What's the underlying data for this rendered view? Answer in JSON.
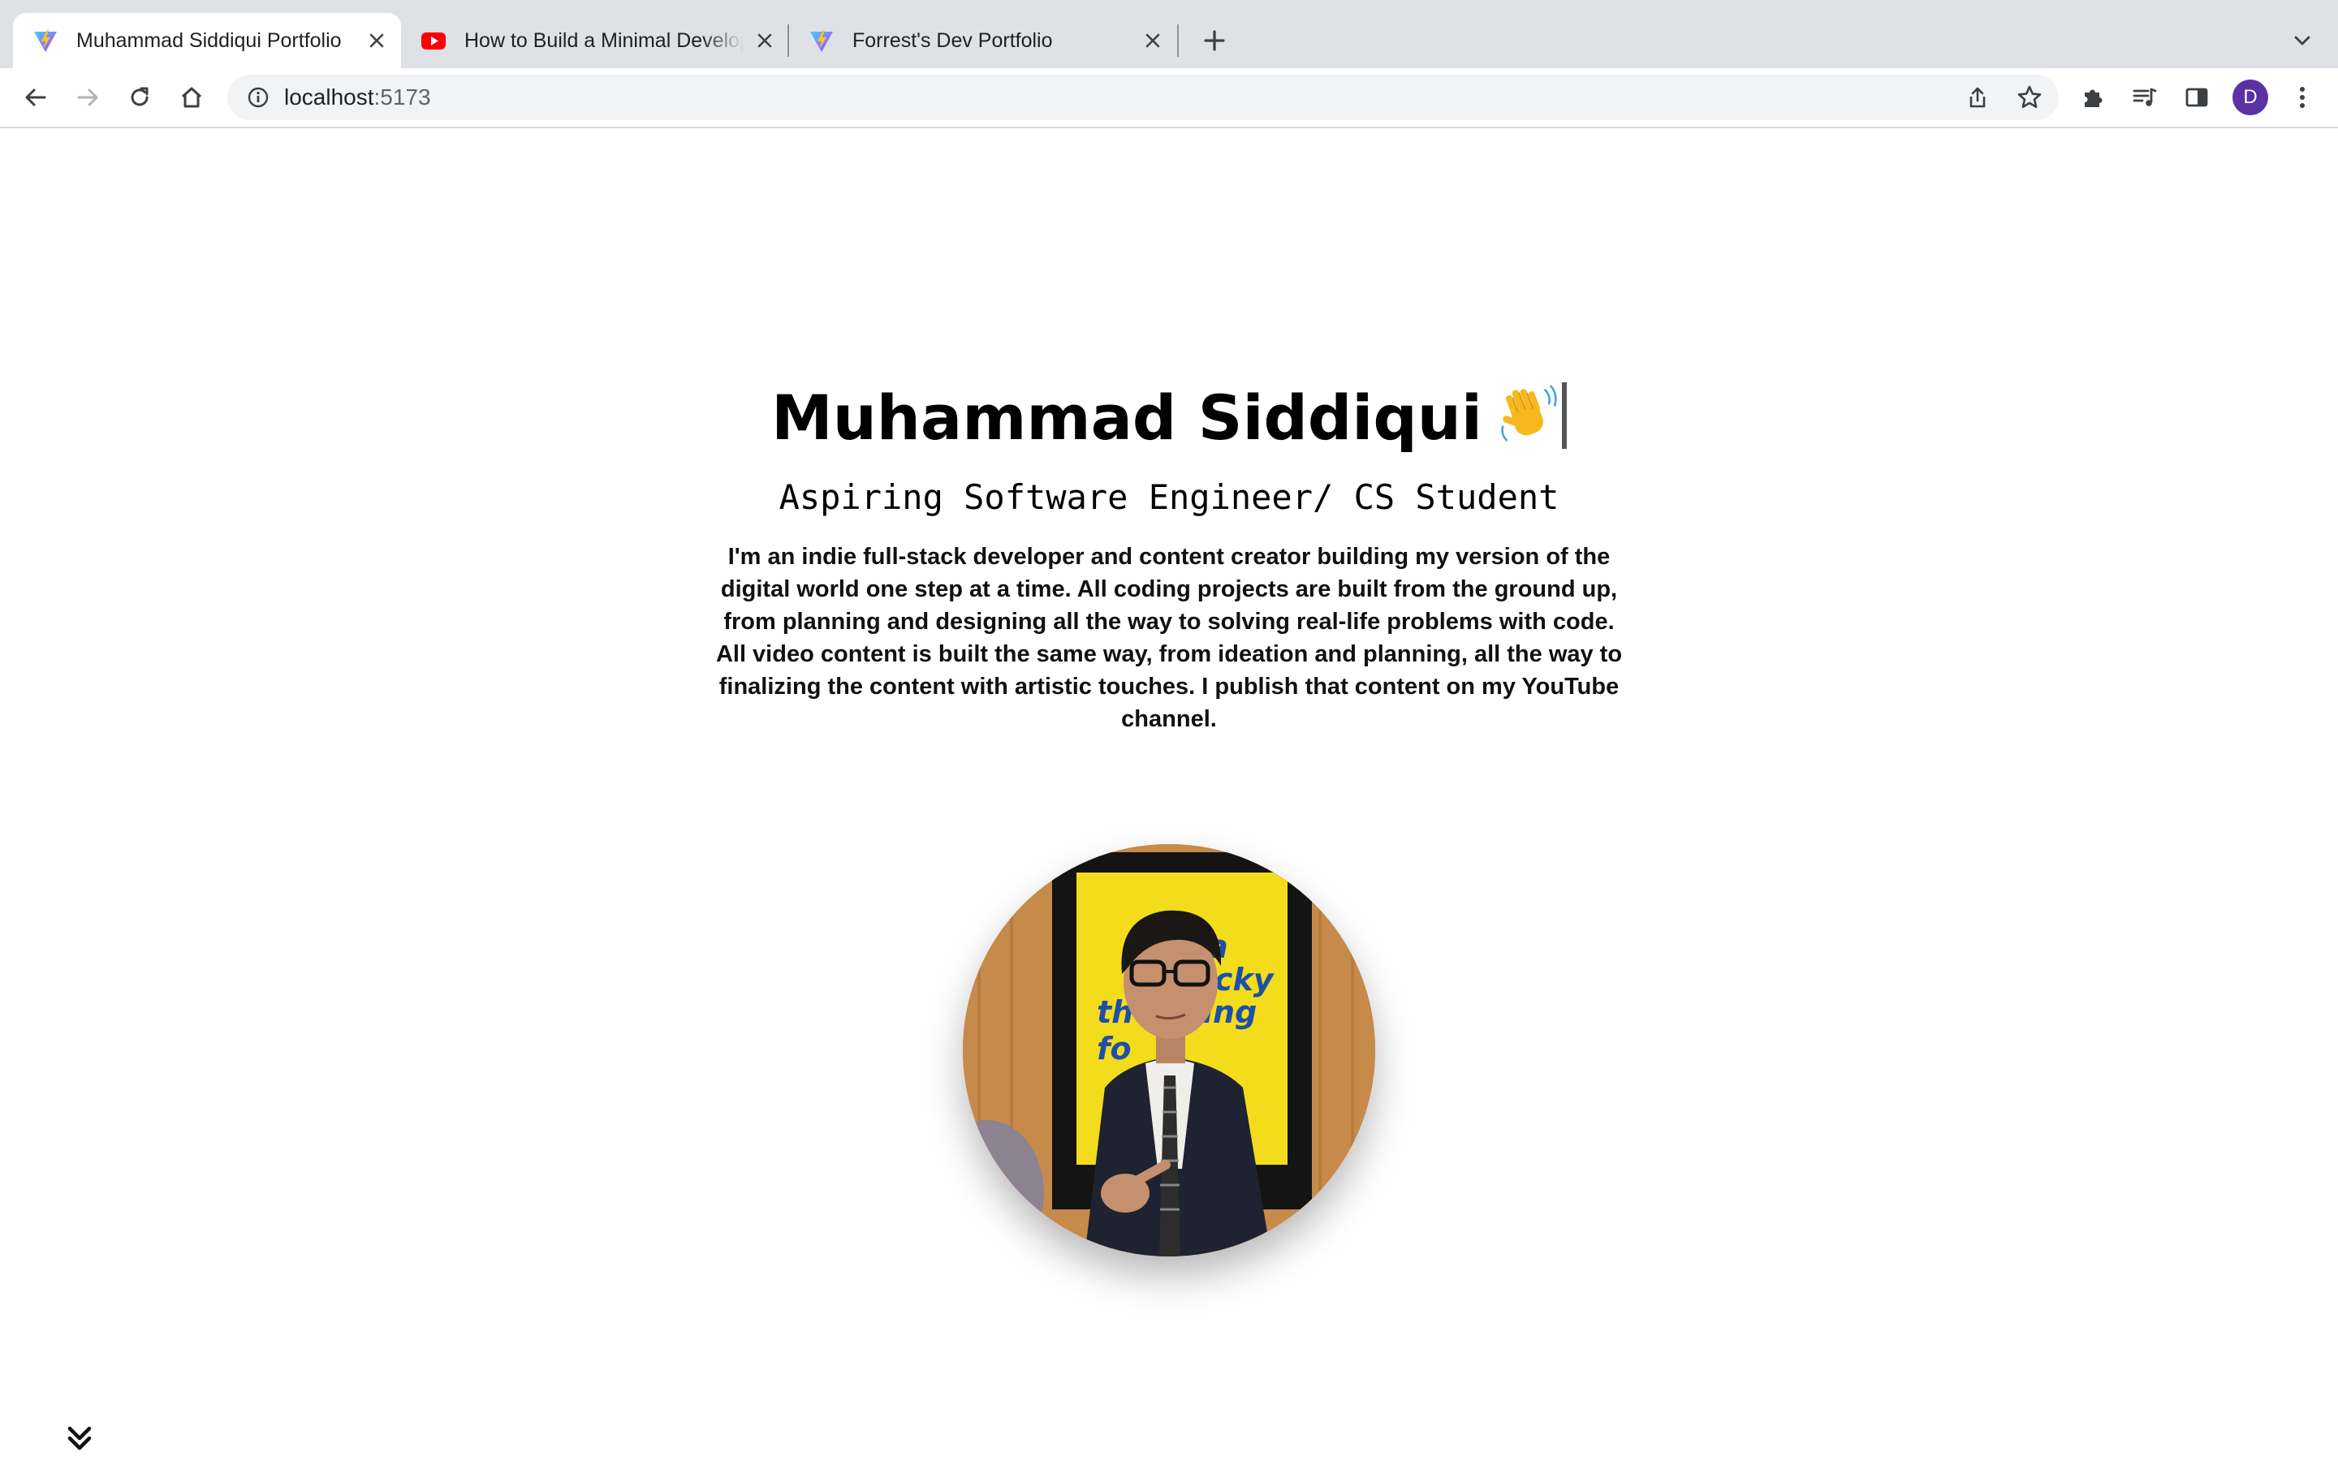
{
  "browser": {
    "tabs": [
      {
        "title": "Muhammad Siddiqui Portfolio",
        "icon": "vite-icon",
        "active": true
      },
      {
        "title": "How to Build a Minimal Develop",
        "icon": "youtube-icon",
        "active": false
      },
      {
        "title": "Forrest's Dev Portfolio",
        "icon": "vite-icon",
        "active": false
      }
    ],
    "address": {
      "host": "localhost",
      "port": ":5173"
    },
    "profile_initial": "D",
    "colors": {
      "tabstrip_bg": "#dee1e6",
      "omnibox_bg": "#f1f3f4",
      "avatar": "#5a32a3"
    }
  },
  "page": {
    "name": "Muhammad Siddiqui",
    "wave_emoji": "👋",
    "subtitle": "Aspiring Software Engineer/ CS Student",
    "bio": "I'm an indie full-stack developer and content creator building my version of the digital world one step at a time. All coding projects are built from the ground up, from planning and designing all the way to solving real-life problems with code. All video content is built the same way, from ideation and planning, all the way to finalizing the content with artistic touches. I publish that content on my YouTube channel.",
    "portrait_alt": "Portrait photo",
    "scroll_icon": "double-chevron-down-icon"
  }
}
